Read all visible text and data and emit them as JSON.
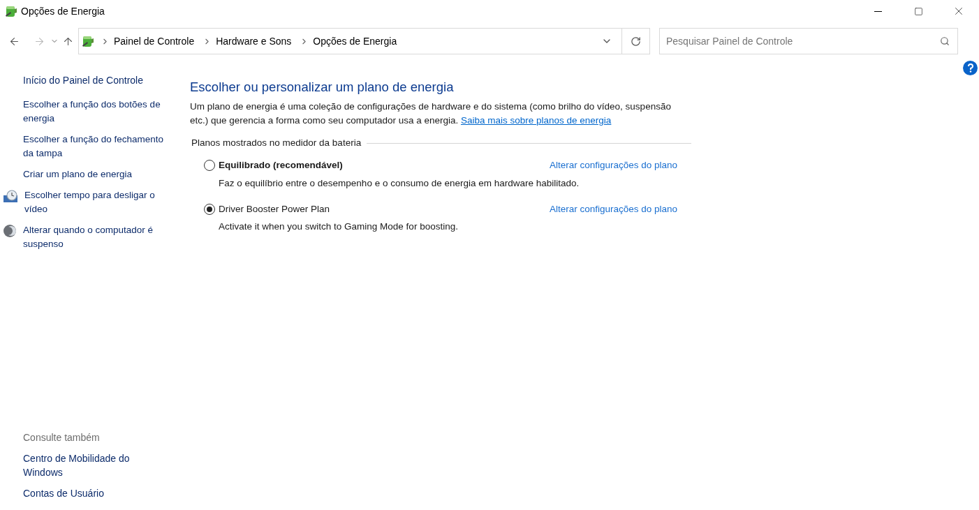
{
  "window": {
    "title": "Opções de Energia"
  },
  "address_bar": {
    "breadcrumbs": [
      "Painel de Controle",
      "Hardware e Sons",
      "Opções de Energia"
    ]
  },
  "search": {
    "placeholder": "Pesquisar Painel de Controle"
  },
  "sidebar": {
    "home": "Início do Painel de Controle",
    "items": [
      {
        "label": "Escolher a função dos botões de energia",
        "kind": "plain"
      },
      {
        "label": "Escolher a função do fechamento da tampa",
        "kind": "plain"
      },
      {
        "label": "Criar um plano de energia",
        "kind": "plain"
      },
      {
        "label": "Escolher tempo para desligar o vídeo",
        "kind": "display"
      },
      {
        "label": "Alterar quando o computador é suspenso",
        "kind": "sleep"
      }
    ],
    "see_also_title": "Consulte também",
    "see_also": [
      "Centro de Mobilidade do Windows",
      "Contas de Usuário"
    ]
  },
  "content": {
    "heading": "Escolher ou personalizar um plano de energia",
    "description": "Um plano de energia é uma coleção de configurações de hardware e do sistema (como brilho do vídeo, suspensão etc.) que gerencia a forma como seu computador usa a energia.",
    "learn_more_link": "Saiba mais sobre planos de energia",
    "group_title": "Planos mostrados no medidor da bateria",
    "plans": [
      {
        "name": "Equilibrado (recomendável)",
        "description": "Faz o equilíbrio entre o desempenho e o consumo de energia em hardware habilitado.",
        "link": "Alterar configurações do plano",
        "selected": false
      },
      {
        "name": "Driver Booster Power Plan",
        "description": "Activate it when you switch to Gaming Mode for boosting.",
        "link": "Alterar configurações do plano",
        "selected": true
      }
    ]
  }
}
